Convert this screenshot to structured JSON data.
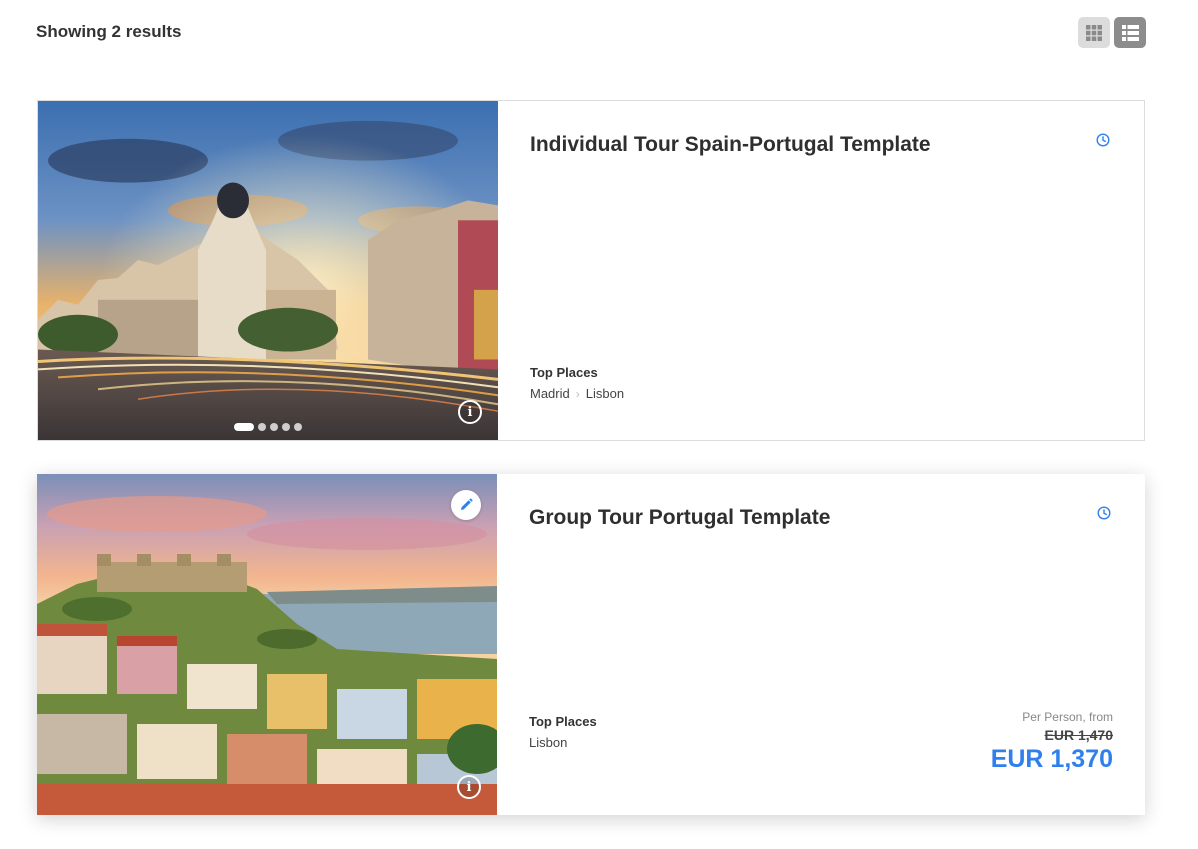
{
  "header": {
    "results_text": "Showing 2 results",
    "view_modes": [
      "grid",
      "list"
    ],
    "active_view": "list"
  },
  "colors": {
    "accent": "#2f80ed",
    "toggle_active": "#8c8c8c",
    "toggle_inactive": "#dcdcdc"
  },
  "tours": [
    {
      "title": "Individual Tour Spain-Portugal Template",
      "image": "Madrid street at sunset (Metropolis building)",
      "top_places_label": "Top Places",
      "places": [
        "Madrid",
        "Lisbon"
      ],
      "carousel_count": 5,
      "carousel_active": 0
    },
    {
      "title": "Group Tour Portugal Template",
      "image": "Lisbon hillside with castle",
      "top_places_label": "Top Places",
      "places": [
        "Lisbon"
      ],
      "price": {
        "note": "Per Person, from",
        "original": "EUR 1,470",
        "current": "EUR 1,370"
      }
    }
  ]
}
